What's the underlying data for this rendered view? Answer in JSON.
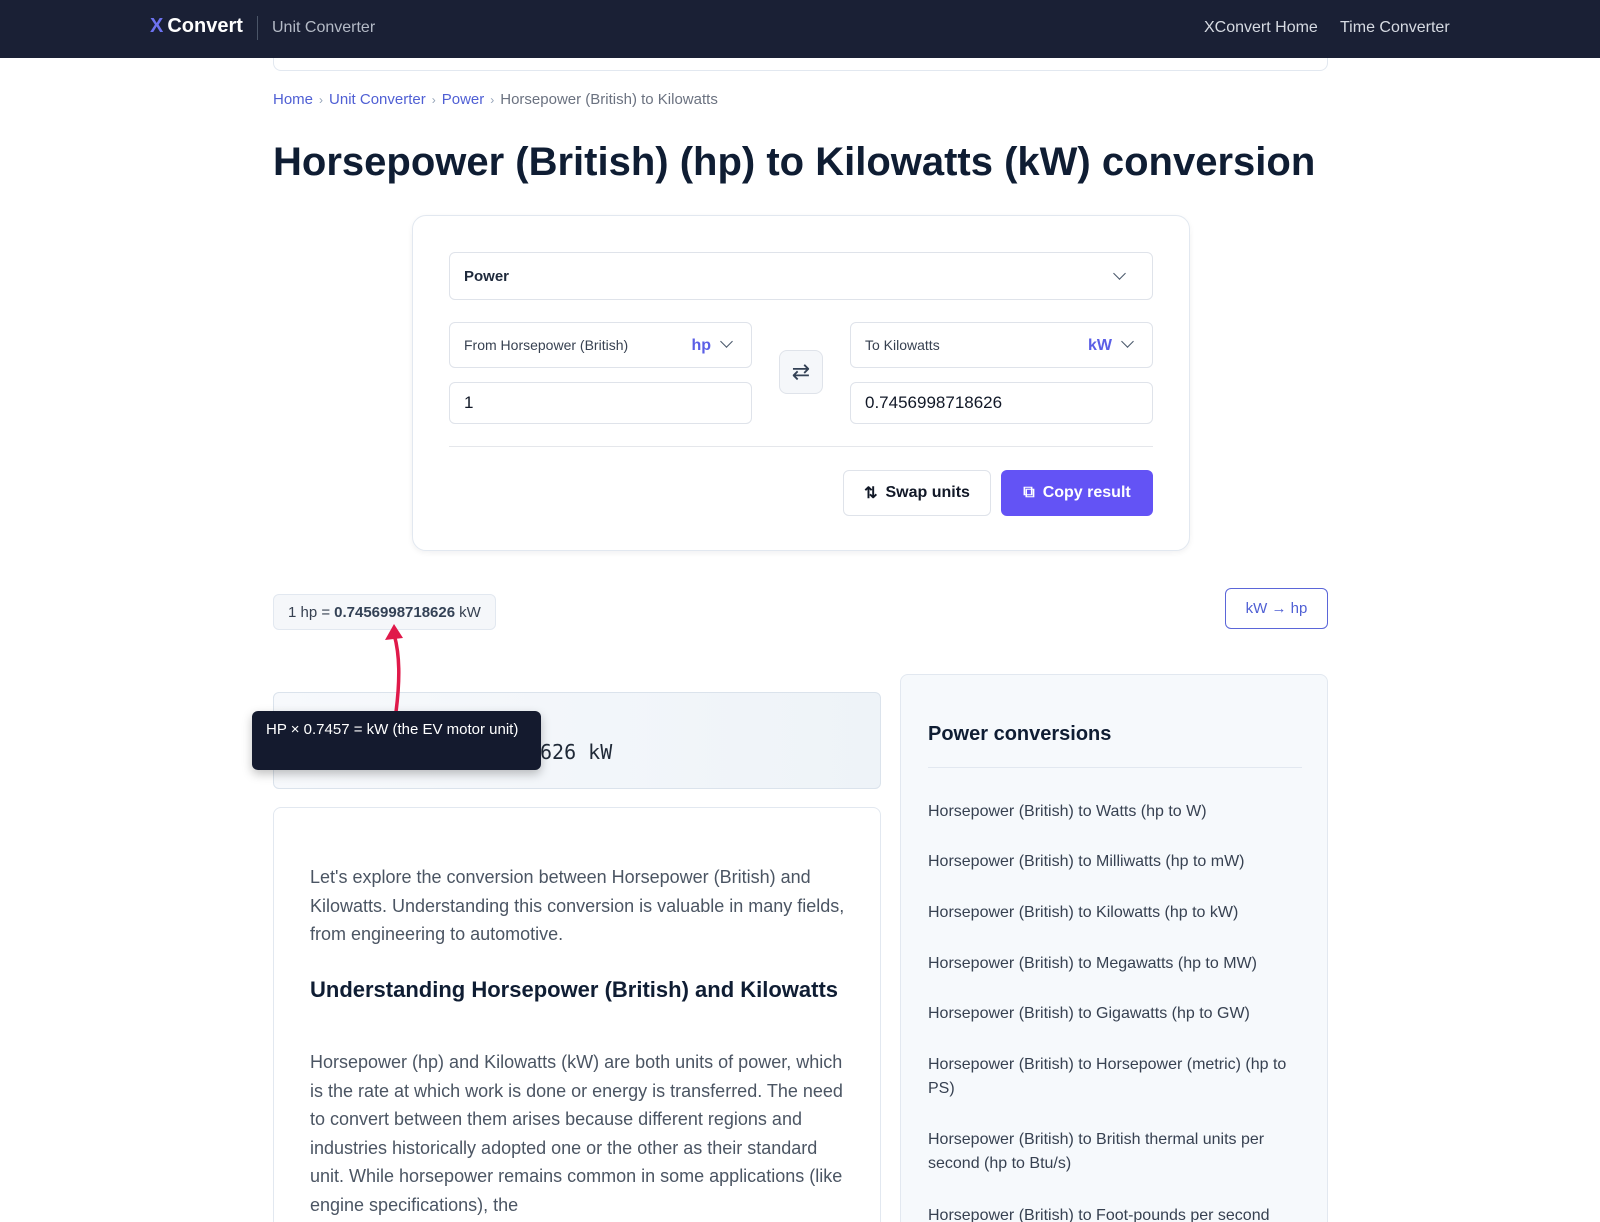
{
  "topbar": {
    "logo_x": "X",
    "logo_text": "Convert",
    "subtitle": "Unit Converter",
    "nav": [
      "XConvert Home",
      "Time Converter"
    ]
  },
  "breadcrumb": {
    "items": [
      "Home",
      "Unit Converter",
      "Power"
    ],
    "current": "Horsepower (British) to Kilowatts"
  },
  "page_title": "Horsepower (British) (hp) to Kilowatts (kW) conversion",
  "converter": {
    "category": "Power",
    "from_label": "From Horsepower (British)",
    "from_abbr": "hp",
    "to_label": "To Kilowatts",
    "to_abbr": "kW",
    "from_value": "1",
    "to_value": "0.7456998718626",
    "swap_label": "Swap units",
    "copy_label": "Copy result",
    "swap_mini_icon": "swap-horizontal-icon"
  },
  "equation": {
    "prefix": "1 hp =",
    "value": "0.7456998718626",
    "suffix": "kW"
  },
  "reverse_button": "kW → hp",
  "formula_visible": "626 kW",
  "tooltip": "HP × 0.7457 = kW (the EV motor unit)",
  "annotation_color": "#e0194a",
  "article": {
    "p1": "Let's explore the conversion between Horsepower (British) and Kilowatts. Understanding this conversion is valuable in many fields, from engineering to automotive.",
    "h2": "Understanding Horsepower (British) and Kilowatts",
    "p2": "Horsepower (hp) and Kilowatts (kW) are both units of power, which is the rate at which work is done or energy is transferred. The need to convert between them arises because different regions and industries historically adopted one or the other as their standard unit. While horsepower remains common in some applications (like engine specifications), the"
  },
  "sidebar": {
    "title": "Power conversions",
    "links": [
      "Horsepower (British) to Watts (hp to W)",
      "Horsepower (British) to Milliwatts (hp to mW)",
      "Horsepower (British) to Kilowatts (hp to kW)",
      "Horsepower (British) to Megawatts (hp to MW)",
      "Horsepower (British) to Gigawatts (hp to GW)",
      "Horsepower (British) to Horsepower (metric) (hp to PS)",
      "Horsepower (British) to British thermal units per second (hp to Btu/s)",
      "Horsepower (British) to Foot-pounds per second"
    ]
  },
  "colors": {
    "topbar": "#1a2035",
    "accent": "#6353f5",
    "link": "#4f5fd4"
  }
}
